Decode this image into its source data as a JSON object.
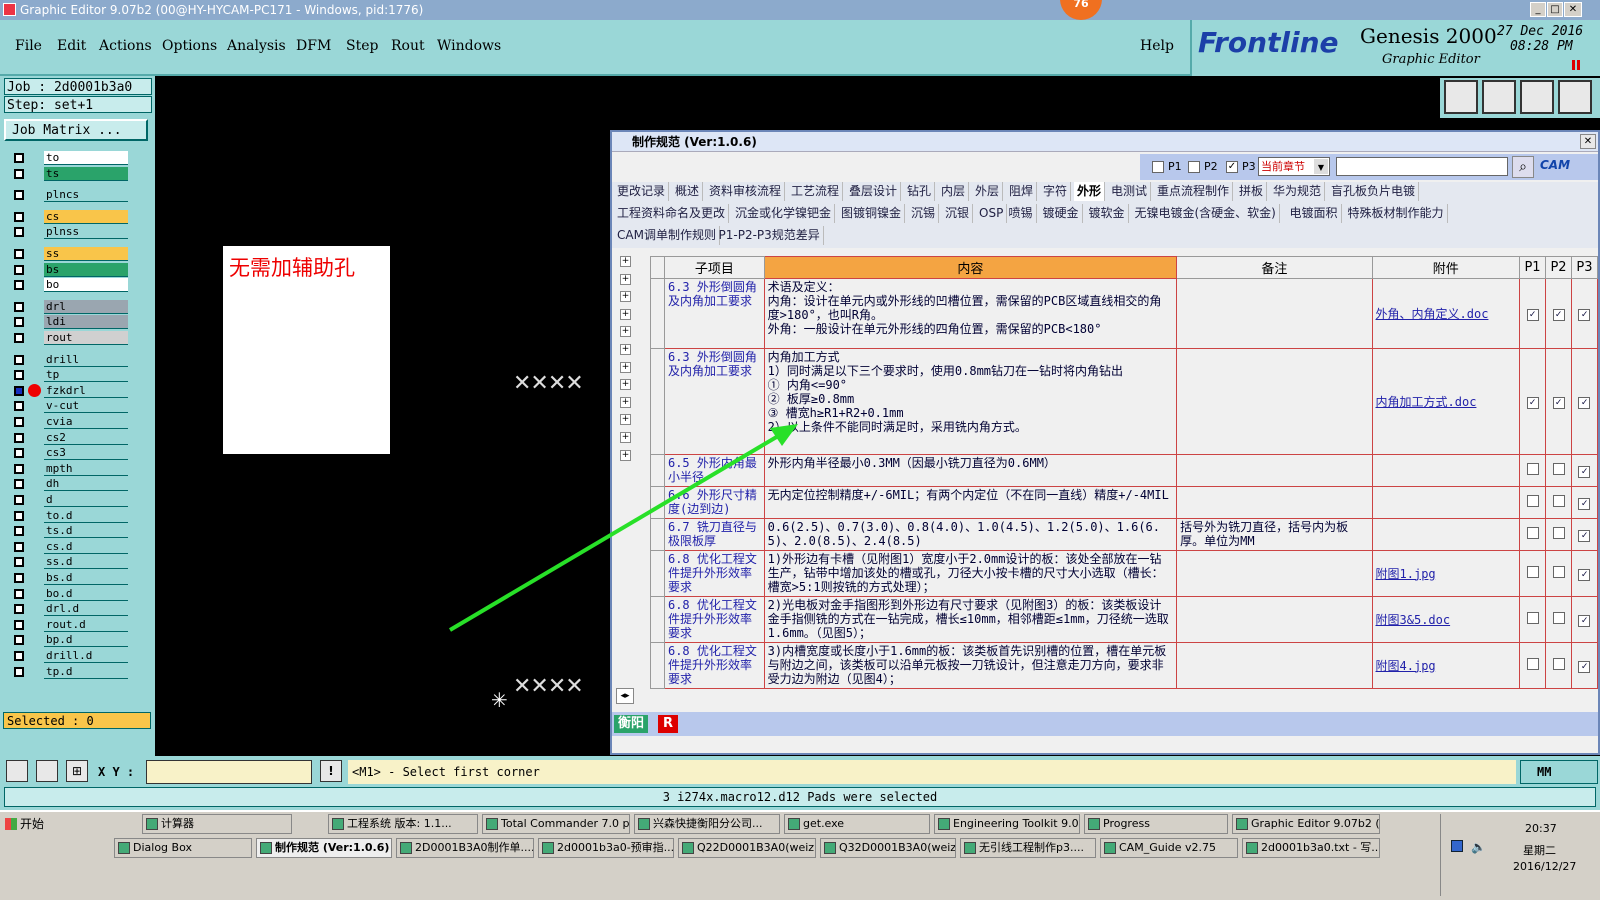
{
  "window": {
    "title": "Graphic Editor 9.07b2 (00@HY-HYCAM-PC171 - Windows, pid:1776)",
    "badge": "76"
  },
  "menu": {
    "items": [
      "File",
      "Edit",
      "Actions",
      "Options",
      "Analysis",
      "DFM",
      "Step",
      "Rout",
      "Windows"
    ],
    "help": "Help"
  },
  "brand": {
    "logo": "Frontline",
    "product": "Genesis 2000",
    "subtitle": "Graphic Editor",
    "date": "27 Dec 2016",
    "time": "08:28 PM"
  },
  "job": {
    "job_line": "Job : 2d0001b3a0",
    "step_line": "Step: set+1",
    "matrix_button": "Job Matrix ...",
    "selected": "Selected : 0"
  },
  "layers": [
    {
      "name": "to",
      "color": "#ffffff"
    },
    {
      "name": "ts",
      "color": "#2aa36a"
    },
    {
      "name": "plncs",
      "color": "#9ad7d7"
    },
    {
      "name": "cs",
      "color": "#f9c54a"
    },
    {
      "name": "plnss",
      "color": "#9ad7d7"
    },
    {
      "name": "ss",
      "color": "#f9c54a"
    },
    {
      "name": "bs",
      "color": "#2aa36a"
    },
    {
      "name": "bo",
      "color": "#ffffff"
    },
    {
      "name": "drl",
      "color": "#9aa6b0"
    },
    {
      "name": "ldi",
      "color": "#9aa6b0"
    },
    {
      "name": "rout",
      "color": "#d0d0d0"
    },
    {
      "name": "drill",
      "color": "#9ad7d7"
    },
    {
      "name": "tp",
      "color": "#9ad7d7"
    },
    {
      "name": "fzkdrl",
      "color": "#9ad7d7"
    },
    {
      "name": "v-cut",
      "color": "#9ad7d7"
    },
    {
      "name": "cvia",
      "color": "#9ad7d7"
    },
    {
      "name": "cs2",
      "color": "#9ad7d7"
    },
    {
      "name": "cs3",
      "color": "#9ad7d7"
    },
    {
      "name": "mpth",
      "color": "#9ad7d7"
    },
    {
      "name": "dh",
      "color": "#9ad7d7"
    },
    {
      "name": "d",
      "color": "#9ad7d7"
    },
    {
      "name": "to.d",
      "color": "#9ad7d7"
    },
    {
      "name": "ts.d",
      "color": "#9ad7d7"
    },
    {
      "name": "cs.d",
      "color": "#9ad7d7"
    },
    {
      "name": "ss.d",
      "color": "#9ad7d7"
    },
    {
      "name": "bs.d",
      "color": "#9ad7d7"
    },
    {
      "name": "bo.d",
      "color": "#9ad7d7"
    },
    {
      "name": "drl.d",
      "color": "#9ad7d7"
    },
    {
      "name": "rout.d",
      "color": "#9ad7d7"
    },
    {
      "name": "bp.d",
      "color": "#9ad7d7"
    },
    {
      "name": "drill.d",
      "color": "#9ad7d7"
    },
    {
      "name": "tp.d",
      "color": "#9ad7d7"
    }
  ],
  "canvas": {
    "note": "无需加辅助孔"
  },
  "dialog": {
    "title": "制作规范 (Ver:1.0.6)",
    "filters": {
      "p1": "P1",
      "p2": "P2",
      "p3": "P3",
      "scope": "当前章节",
      "search_button": "CAM"
    },
    "tabs_row1": [
      "更改记录",
      "概述",
      "资料审核流程",
      "工艺流程",
      "叠层设计",
      "钻孔",
      "内层",
      "外层",
      "阻焊",
      "字符",
      "外形",
      "电测试",
      "重点流程制作",
      "拼板",
      "华为规范",
      "盲孔板负片电镀"
    ],
    "tabs_row2": [
      "工程资料命名及更改",
      "沉金或化学镍钯金",
      "图镀铜镍金",
      "沉锡",
      "沉银",
      "OSP",
      "喷锡",
      "镀硬金",
      "镀软金",
      "无镍电镀金(含硬金、软金)",
      "电镀面积",
      "特殊板材制作能力"
    ],
    "tabs_row3": [
      "CAM调单制作规则",
      "P1-P2-P3规范差异"
    ],
    "active_tab": "外形",
    "columns": {
      "item": "子项目",
      "content": "内容",
      "note": "备注",
      "attachment": "附件",
      "p1": "P1",
      "p2": "P2",
      "p3": "P3"
    },
    "rows": [
      {
        "item": "6.3 外形倒圆角及内角加工要求",
        "content": "术语及定义：\n内角：设计在单元内或外形线的凹槽位置，需保留的PCB区域直线相交的角度>180°，也叫R角。\n外角：一般设计在单元外形线的四角位置，需保留的PCB<180°",
        "note": "",
        "attachment": "外角、内角定义.doc",
        "p1": "✓",
        "p2": "✓",
        "p3": "✓"
      },
      {
        "item": "6.3 外形倒圆角及内角加工要求",
        "content": "内角加工方式\n1）同时满足以下三个要求时，使用0.8mm钻刀在一钻时将内角钻出\n① 内角<=90°\n② 板厚≥0.8mm\n③ 槽宽h≥R1+R2+0.1mm\n2）以上条件不能同时满足时，采用铣内角方式。",
        "note": "",
        "attachment": "内角加工方式.doc",
        "p1": "✓",
        "p2": "✓",
        "p3": "✓"
      },
      {
        "item": "6.5 外形内角最小半径",
        "content": "外形内角半径最小0.3MM（因最小铣刀直径为0.6MM）",
        "note": "",
        "attachment": "",
        "p1": "",
        "p2": "",
        "p3": "✓"
      },
      {
        "item": "6.6 外形尺寸精度(边到边)",
        "content": "无内定位控制精度+/-6MIL；有两个内定位（不在同一直线）精度+/-4MIL",
        "note": "",
        "attachment": "",
        "p1": "",
        "p2": "",
        "p3": "✓"
      },
      {
        "item": "6.7 铣刀直径与极限板厚",
        "content": "0.6(2.5)、0.7(3.0)、0.8(4.0)、1.0(4.5)、1.2(5.0)、1.6(6.5)、2.0(8.5)、2.4(8.5)",
        "note": "括号外为铣刀直径，括号内为板厚。单位为MM",
        "attachment": "",
        "p1": "",
        "p2": "",
        "p3": "✓"
      },
      {
        "item": "6.8 优化工程文件提升外形效率要求",
        "content": "1)外形边有卡槽（见附图1）宽度小于2.0mm设计的板：该处全部放在一钻生产，钻带中增加该处的槽或孔，刀径大小按卡槽的尺寸大小选取（槽长：槽宽>5:1则按铣的方式处理）；",
        "note": "",
        "attachment": "附图1.jpg",
        "p1": "",
        "p2": "",
        "p3": "✓"
      },
      {
        "item": "6.8 优化工程文件提升外形效率要求",
        "content": "2)光电板对金手指图形到外形边有尺寸要求（见附图3）的板：该类板设计金手指侧铣的方式在一钻完成，槽长≤10mm，相邻槽距≤1mm，刀径统一选取1.6mm。（见图5）；",
        "note": "",
        "attachment": "附图3&5.doc",
        "p1": "",
        "p2": "",
        "p3": "✓"
      },
      {
        "item": "6.8 优化工程文件提升外形效率要求",
        "content": "3)内槽宽度或长度小于1.6mm的板：该类板首先识别槽的位置，槽在单元板与附边之间，该类板可以沿单元板按一刀铣设计，但注意走刀方向，要求非受力边为附边（见图4）；",
        "note": "",
        "attachment": "附图4.jpg",
        "p1": "",
        "p2": "",
        "p3": "✓"
      }
    ],
    "footer_tags": [
      "衡阳",
      "R"
    ]
  },
  "command": {
    "xy_label": "X Y :",
    "prompt": "<M1> - Select first corner",
    "unit": "MM",
    "status": "3 i274x.macro12.d12 Pads were selected"
  },
  "taskbar": {
    "start": "开始",
    "row1": [
      "计算器",
      "工程系统 版本: 1.1...",
      "Total Commander 7.0 p...",
      "兴森快捷衡阳分公司...",
      "get.exe",
      "Engineering Toolkit 9.0...",
      "Progress",
      "Graphic Editor 9.07b2 (..."
    ],
    "row2": [
      "Dialog Box",
      "制作规范 (Ver:1.0.6)",
      "2D0001B3A0制作单....",
      "2d0001b3a0-预审指...",
      "Q22D0001B3A0(weiz...",
      "Q32D0001B3A0(weiz...",
      "无引线工程制作p3....",
      "CAM_Guide v2.75",
      "2d0001b3a0.txt - 写..."
    ],
    "clock": "20:37",
    "weekday": "星期二",
    "date": "2016/12/27"
  }
}
